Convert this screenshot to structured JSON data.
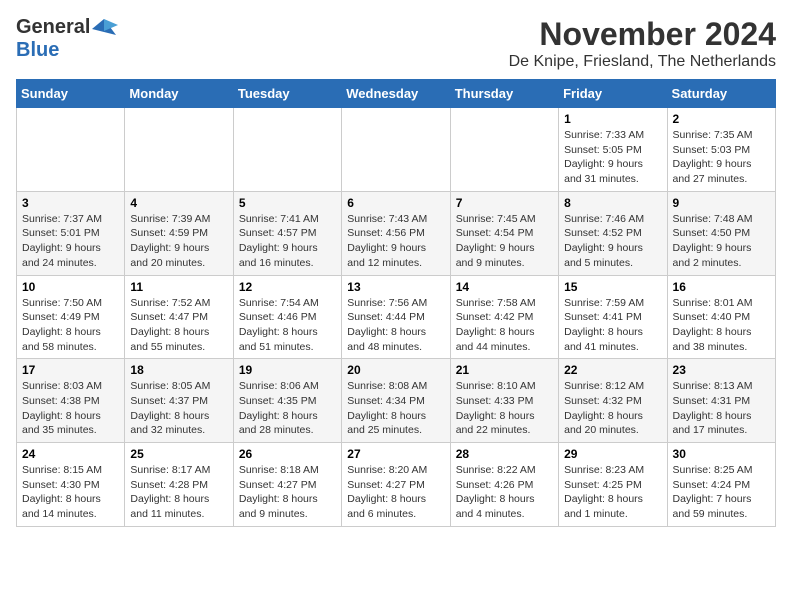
{
  "header": {
    "logo_general": "General",
    "logo_blue": "Blue",
    "month_title": "November 2024",
    "location": "De Knipe, Friesland, The Netherlands"
  },
  "weekdays": [
    "Sunday",
    "Monday",
    "Tuesday",
    "Wednesday",
    "Thursday",
    "Friday",
    "Saturday"
  ],
  "weeks": [
    [
      {
        "day": "",
        "info": ""
      },
      {
        "day": "",
        "info": ""
      },
      {
        "day": "",
        "info": ""
      },
      {
        "day": "",
        "info": ""
      },
      {
        "day": "",
        "info": ""
      },
      {
        "day": "1",
        "info": "Sunrise: 7:33 AM\nSunset: 5:05 PM\nDaylight: 9 hours and 31 minutes."
      },
      {
        "day": "2",
        "info": "Sunrise: 7:35 AM\nSunset: 5:03 PM\nDaylight: 9 hours and 27 minutes."
      }
    ],
    [
      {
        "day": "3",
        "info": "Sunrise: 7:37 AM\nSunset: 5:01 PM\nDaylight: 9 hours and 24 minutes."
      },
      {
        "day": "4",
        "info": "Sunrise: 7:39 AM\nSunset: 4:59 PM\nDaylight: 9 hours and 20 minutes."
      },
      {
        "day": "5",
        "info": "Sunrise: 7:41 AM\nSunset: 4:57 PM\nDaylight: 9 hours and 16 minutes."
      },
      {
        "day": "6",
        "info": "Sunrise: 7:43 AM\nSunset: 4:56 PM\nDaylight: 9 hours and 12 minutes."
      },
      {
        "day": "7",
        "info": "Sunrise: 7:45 AM\nSunset: 4:54 PM\nDaylight: 9 hours and 9 minutes."
      },
      {
        "day": "8",
        "info": "Sunrise: 7:46 AM\nSunset: 4:52 PM\nDaylight: 9 hours and 5 minutes."
      },
      {
        "day": "9",
        "info": "Sunrise: 7:48 AM\nSunset: 4:50 PM\nDaylight: 9 hours and 2 minutes."
      }
    ],
    [
      {
        "day": "10",
        "info": "Sunrise: 7:50 AM\nSunset: 4:49 PM\nDaylight: 8 hours and 58 minutes."
      },
      {
        "day": "11",
        "info": "Sunrise: 7:52 AM\nSunset: 4:47 PM\nDaylight: 8 hours and 55 minutes."
      },
      {
        "day": "12",
        "info": "Sunrise: 7:54 AM\nSunset: 4:46 PM\nDaylight: 8 hours and 51 minutes."
      },
      {
        "day": "13",
        "info": "Sunrise: 7:56 AM\nSunset: 4:44 PM\nDaylight: 8 hours and 48 minutes."
      },
      {
        "day": "14",
        "info": "Sunrise: 7:58 AM\nSunset: 4:42 PM\nDaylight: 8 hours and 44 minutes."
      },
      {
        "day": "15",
        "info": "Sunrise: 7:59 AM\nSunset: 4:41 PM\nDaylight: 8 hours and 41 minutes."
      },
      {
        "day": "16",
        "info": "Sunrise: 8:01 AM\nSunset: 4:40 PM\nDaylight: 8 hours and 38 minutes."
      }
    ],
    [
      {
        "day": "17",
        "info": "Sunrise: 8:03 AM\nSunset: 4:38 PM\nDaylight: 8 hours and 35 minutes."
      },
      {
        "day": "18",
        "info": "Sunrise: 8:05 AM\nSunset: 4:37 PM\nDaylight: 8 hours and 32 minutes."
      },
      {
        "day": "19",
        "info": "Sunrise: 8:06 AM\nSunset: 4:35 PM\nDaylight: 8 hours and 28 minutes."
      },
      {
        "day": "20",
        "info": "Sunrise: 8:08 AM\nSunset: 4:34 PM\nDaylight: 8 hours and 25 minutes."
      },
      {
        "day": "21",
        "info": "Sunrise: 8:10 AM\nSunset: 4:33 PM\nDaylight: 8 hours and 22 minutes."
      },
      {
        "day": "22",
        "info": "Sunrise: 8:12 AM\nSunset: 4:32 PM\nDaylight: 8 hours and 20 minutes."
      },
      {
        "day": "23",
        "info": "Sunrise: 8:13 AM\nSunset: 4:31 PM\nDaylight: 8 hours and 17 minutes."
      }
    ],
    [
      {
        "day": "24",
        "info": "Sunrise: 8:15 AM\nSunset: 4:30 PM\nDaylight: 8 hours and 14 minutes."
      },
      {
        "day": "25",
        "info": "Sunrise: 8:17 AM\nSunset: 4:28 PM\nDaylight: 8 hours and 11 minutes."
      },
      {
        "day": "26",
        "info": "Sunrise: 8:18 AM\nSunset: 4:27 PM\nDaylight: 8 hours and 9 minutes."
      },
      {
        "day": "27",
        "info": "Sunrise: 8:20 AM\nSunset: 4:27 PM\nDaylight: 8 hours and 6 minutes."
      },
      {
        "day": "28",
        "info": "Sunrise: 8:22 AM\nSunset: 4:26 PM\nDaylight: 8 hours and 4 minutes."
      },
      {
        "day": "29",
        "info": "Sunrise: 8:23 AM\nSunset: 4:25 PM\nDaylight: 8 hours and 1 minute."
      },
      {
        "day": "30",
        "info": "Sunrise: 8:25 AM\nSunset: 4:24 PM\nDaylight: 7 hours and 59 minutes."
      }
    ]
  ]
}
